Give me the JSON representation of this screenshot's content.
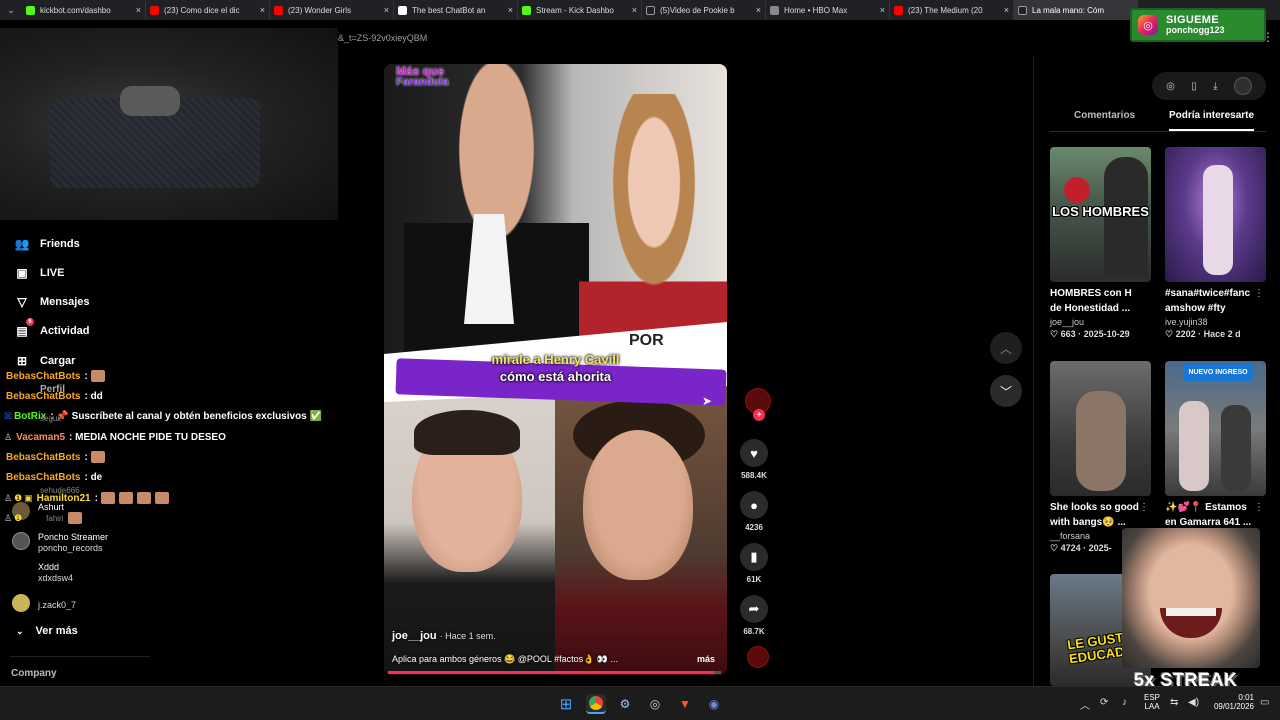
{
  "browser": {
    "tabs": [
      {
        "label": "kickbot.com/dashbo",
        "color": "#53fc18"
      },
      {
        "label": "(23) Como dice el dic",
        "color": "#ff0000"
      },
      {
        "label": "(23) Wonder Girls",
        "color": "#ff0000"
      },
      {
        "label": "The best ChatBot an",
        "color": "#ffffff"
      },
      {
        "label": "Stream - Kick Dashbo",
        "color": "#53fc18"
      },
      {
        "label": "(5)Video de Pookie b",
        "color": "#222222"
      },
      {
        "label": "Home • HBO Max",
        "color": "#888888"
      },
      {
        "label": "(23) The Medium (20",
        "color": "#ff0000"
      },
      {
        "label": "La mala mano: Cóm",
        "color": "#222222"
      }
    ],
    "url_fragment": "&_t=ZS-92v0xieyQBM"
  },
  "follow_banner": {
    "line1": "SIGUEME",
    "line2": "ponchogg123",
    "icon": "instagram-icon"
  },
  "left_nav": {
    "items": [
      {
        "label": "Friends",
        "icon": "friends-icon"
      },
      {
        "label": "LIVE",
        "icon": "live-icon"
      },
      {
        "label": "Mensajes",
        "icon": "messages-icon"
      },
      {
        "label": "Actividad",
        "icon": "activity-icon",
        "badge": "6"
      },
      {
        "label": "Cargar",
        "icon": "upload-icon"
      },
      {
        "label": "Perfil",
        "icon": "profile-icon"
      }
    ],
    "accounts": [
      {
        "name": "Poncho Streamer",
        "handle": "poncho_records"
      },
      {
        "name": "Xddd",
        "handle": "xdxdsw4"
      },
      {
        "name": "",
        "handle": "j.zack0_7"
      }
    ],
    "ghost_texts": [
      "seguir",
      "sehude666",
      "Ashurt",
      "fahiri"
    ],
    "see_more": "Ver más",
    "company": "Company"
  },
  "chat": {
    "lines": [
      {
        "user": "BebasChatBots",
        "msg": ":",
        "color": "#f9a825"
      },
      {
        "user": "BebasChatBots",
        "msg": ": dd",
        "color": "#f9a825"
      },
      {
        "user": "BotRix",
        "msg": ": 📌 Suscríbete al canal y obtén beneficios exclusivos ✅",
        "color": "#53fc18"
      },
      {
        "user": "Vacaman5",
        "msg": ": MEDIA NOCHE PIDE TU DESEO",
        "color": "#ff8a65"
      },
      {
        "user": "BebasChatBots",
        "msg": ":",
        "color": "#f9a825"
      },
      {
        "user": "BebasChatBots",
        "msg": ": de",
        "color": "#f9a825"
      },
      {
        "user": "Hamilton21",
        "msg": ":",
        "color": "#fdd835"
      },
      {
        "user": "",
        "msg": "",
        "color": "#fdd835"
      }
    ]
  },
  "video": {
    "logo_line1": "Más que",
    "logo_line2": "Farandula",
    "por_text": "POR",
    "caption_line1": "mírale a Henry Cavill",
    "caption_line2": "cómo está ahorita",
    "author": "joe__jou",
    "ago": "· Hace 1 sem.",
    "description": "Aplica para ambos géneros 😂 @POOL  #factos👌 👀 ...",
    "more": "más",
    "progress": 0.98
  },
  "actions": {
    "likes": "588.4K",
    "comments": "4236",
    "saves": "61K",
    "shares": "68.7K"
  },
  "right_panel": {
    "tabs": [
      "Comentarios",
      "Podría interesarte"
    ],
    "active_tab": 1,
    "cards": [
      {
        "overlay": "LOS HOMBRES",
        "title1": "HOMBRES con H",
        "title2": "de Honestidad ...",
        "user": "joe__jou",
        "likes": "663",
        "date": "2025-10-29"
      },
      {
        "overlay": "",
        "title1": "#sana#twice#fanc",
        "title2": "amshow #fty",
        "user": "ive.yujin38",
        "likes": "2202",
        "date": "Hace 2 d"
      },
      {
        "overlay": "",
        "title1": "She looks so good",
        "title2": "with bangs🥺 ...",
        "user": "__forsana",
        "likes": "4724",
        "date": "2025-"
      },
      {
        "overlay": "NUEVO INGRESO",
        "title1": "✨💕📍 Estamos",
        "title2": "en Gamarra 641 ...",
        "user": "",
        "likes": "",
        "date": ""
      },
      {
        "overlay": "LE GUSTA EDUCADA",
        "title1": "",
        "title2": "",
        "user": "",
        "likes": "",
        "date": ""
      }
    ]
  },
  "overlay": {
    "streak": "5x STREAK"
  },
  "taskbar": {
    "lang1": "ESP",
    "lang2": "LAA",
    "time": "0:01",
    "date": "09/01/2026"
  }
}
